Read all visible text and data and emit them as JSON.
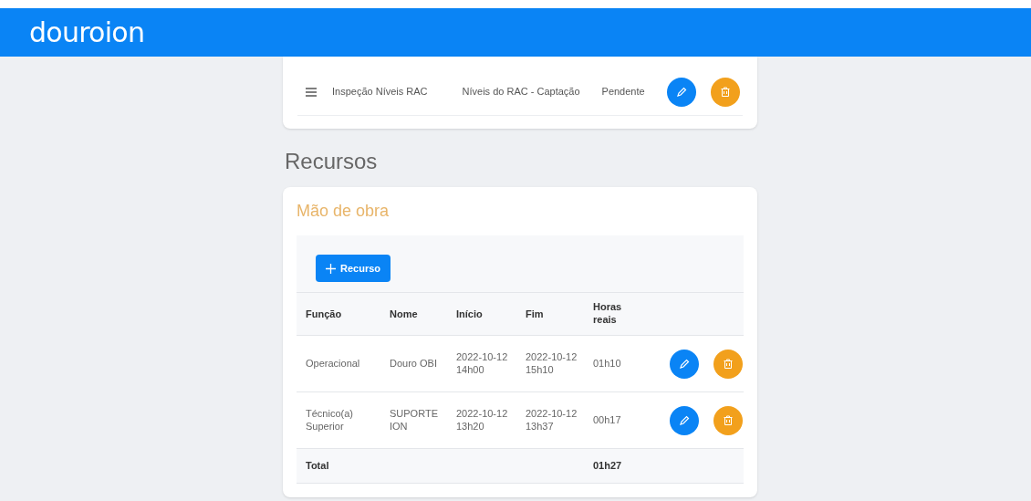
{
  "header": {
    "logo": "douroion"
  },
  "task_row": {
    "name": "Inspeção Níveis RAC",
    "description": "Níveis do RAC - Captação",
    "status": "Pendente"
  },
  "section_title": "Recursos",
  "card": {
    "title": "Mão de obra",
    "add_button": "Recurso",
    "columns": [
      "Função",
      "Nome",
      "Início",
      "Fim",
      "Horas reais"
    ],
    "rows": [
      {
        "cells": [
          "Operacional",
          "Douro OBI",
          "2022-10-12 14h00",
          "2022-10-12 15h10",
          "01h10"
        ]
      },
      {
        "cells": [
          "Técnico(a) Superior",
          "SUPORTE ION",
          "2022-10-12 13h20",
          "2022-10-12 13h37",
          "00h17"
        ]
      }
    ],
    "total": {
      "label": "Total",
      "value": "01h27"
    }
  }
}
